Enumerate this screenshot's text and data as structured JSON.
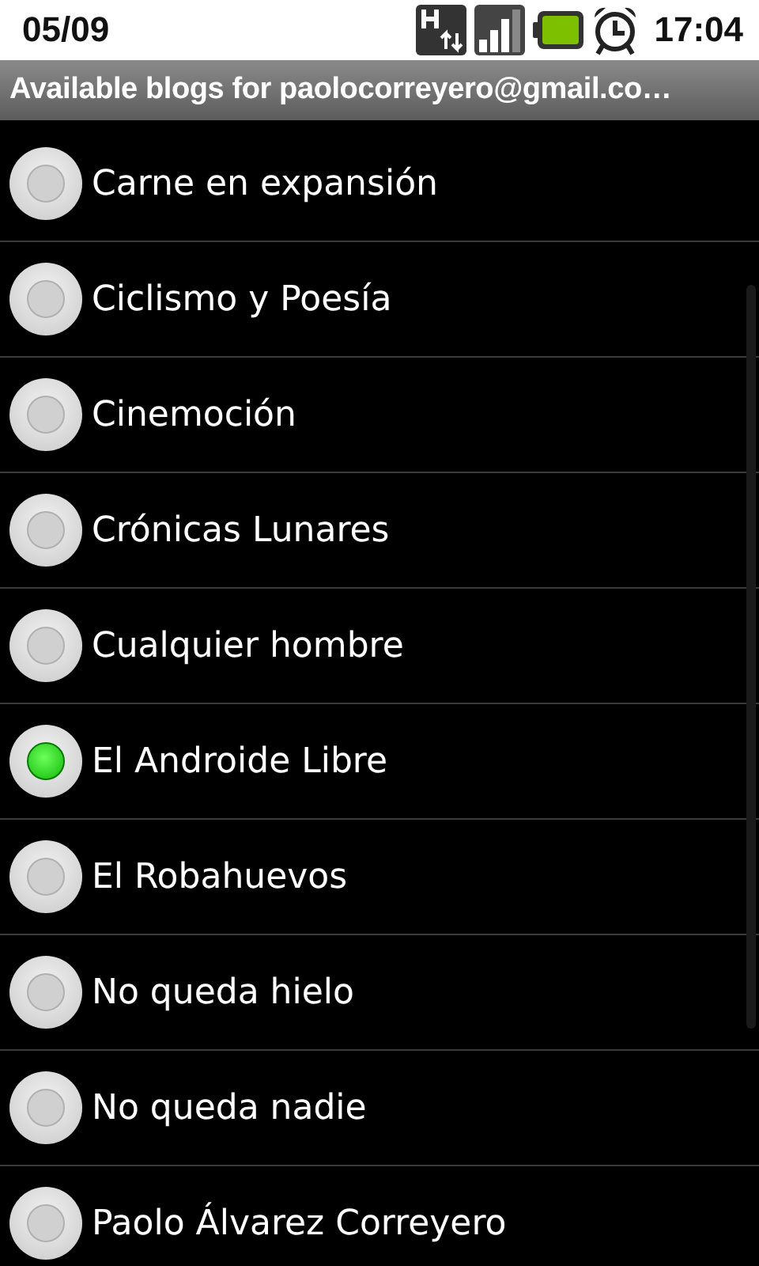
{
  "status_bar": {
    "date": "05/09",
    "time": "17:04"
  },
  "title": "Available blogs for paolocorreyero@gmail.co…",
  "blogs": [
    {
      "name": "Carne en expansión",
      "selected": false
    },
    {
      "name": "Ciclismo y Poesía",
      "selected": false
    },
    {
      "name": "Cinemoción",
      "selected": false
    },
    {
      "name": "Crónicas Lunares",
      "selected": false
    },
    {
      "name": "Cualquier hombre",
      "selected": false
    },
    {
      "name": "El Androide Libre",
      "selected": true
    },
    {
      "name": "El Robahuevos",
      "selected": false
    },
    {
      "name": "No queda hielo",
      "selected": false
    },
    {
      "name": "No queda nadie",
      "selected": false
    },
    {
      "name": "Paolo Álvarez Correyero",
      "selected": false
    }
  ]
}
